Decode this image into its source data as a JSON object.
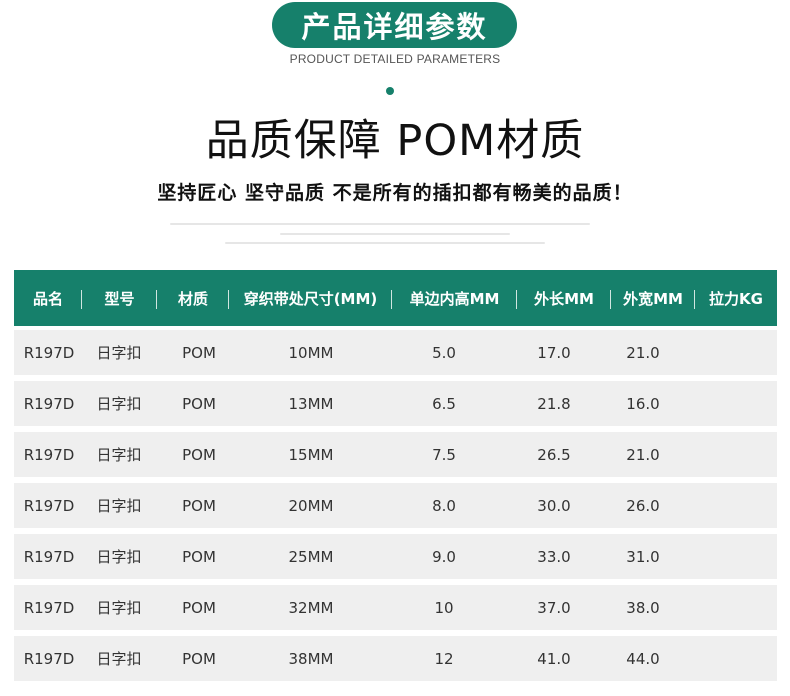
{
  "header": {
    "title": "产品详细参数",
    "subtitle_en": "PRODUCT DETAILED PARAMETERS"
  },
  "headline": "品质保障 POM材质",
  "slogan": "坚持匠心 坚守品质 不是所有的插扣都有畅美的品质！",
  "table": {
    "headers": [
      "品名",
      "型号",
      "材质",
      "穿织带处尺寸(MM)",
      "单边内高MM",
      "外长MM",
      "外宽MM",
      "拉力KG"
    ],
    "rows": [
      [
        "R197D",
        "日字扣",
        "POM",
        "10MM",
        "5.0",
        "17.0",
        "21.0",
        ""
      ],
      [
        "R197D",
        "日字扣",
        "POM",
        "13MM",
        "6.5",
        "21.8",
        "16.0",
        ""
      ],
      [
        "R197D",
        "日字扣",
        "POM",
        "15MM",
        "7.5",
        "26.5",
        "21.0",
        ""
      ],
      [
        "R197D",
        "日字扣",
        "POM",
        "20MM",
        "8.0",
        "30.0",
        "26.0",
        ""
      ],
      [
        "R197D",
        "日字扣",
        "POM",
        "25MM",
        "9.0",
        "33.0",
        "31.0",
        ""
      ],
      [
        "R197D",
        "日字扣",
        "POM",
        "32MM",
        "10",
        "37.0",
        "38.0",
        ""
      ],
      [
        "R197D",
        "日字扣",
        "POM",
        "38MM",
        "12",
        "41.0",
        "44.0",
        ""
      ]
    ]
  },
  "colors": {
    "accent": "#16806b",
    "row_background": "#efefef"
  }
}
